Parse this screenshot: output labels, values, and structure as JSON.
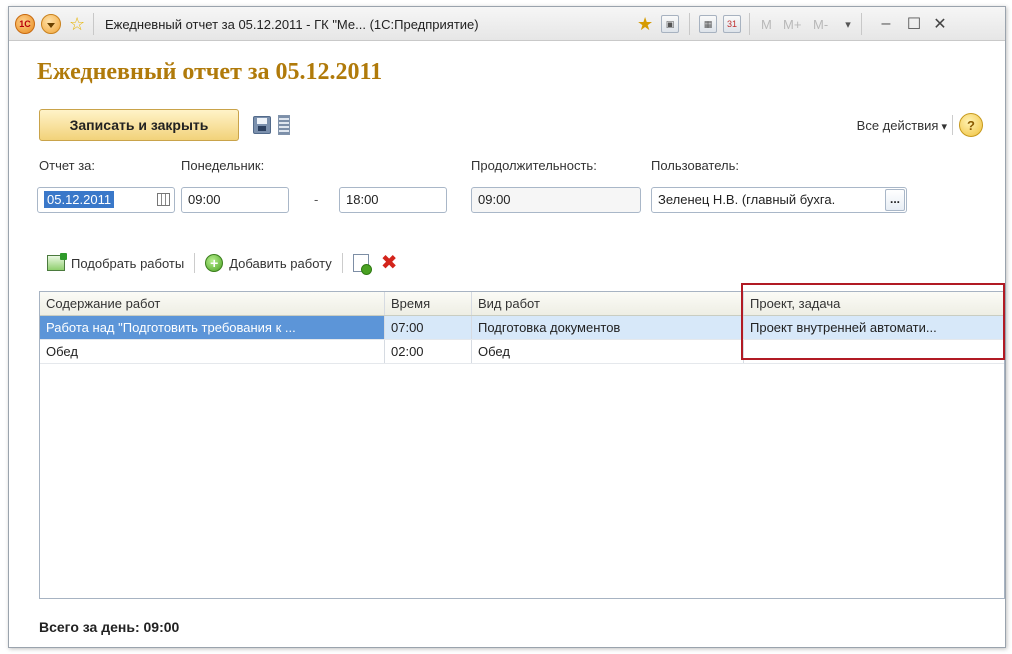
{
  "window": {
    "title": "Ежедневный отчет за 05.12.2011 - ГК \"Ме... (1С:Предприятие)",
    "logo_text": "1С",
    "mem_buttons": [
      "M",
      "M+",
      "M-"
    ]
  },
  "form": {
    "title": "Ежедневный отчет за 05.12.2011",
    "save_close_label": "Записать и закрыть",
    "all_actions_label": "Все действия",
    "help_label": "?"
  },
  "fields": {
    "report_for_label": "Отчет за:",
    "report_date": "05.12.2011",
    "weekday_label": "Понедельник:",
    "time_from": "09:00",
    "time_dash": "-",
    "time_to": "18:00",
    "duration_label": "Продолжительность:",
    "duration": "09:00",
    "user_label": "Пользователь:",
    "user_value": "Зеленец Н.В. (главный бухга.",
    "user_select_label": "..."
  },
  "toolbar": {
    "pick_label": "Подобрать работы",
    "add_label": "Добавить работу",
    "delete_label": "✖"
  },
  "table": {
    "columns": [
      "Содержание работ",
      "Время",
      "Вид работ",
      "Проект, задача"
    ],
    "rows": [
      [
        "Работа над \"Подготовить требования к ...",
        "07:00",
        "Подготовка документов",
        "Проект внутренней автомати..."
      ],
      [
        "Обед",
        "02:00",
        "Обед",
        ""
      ]
    ]
  },
  "total": "Всего за день: 09:00",
  "colors": {
    "title": "#b07a0a",
    "highlight": "#b11a24",
    "selection": "#5c95d8"
  }
}
